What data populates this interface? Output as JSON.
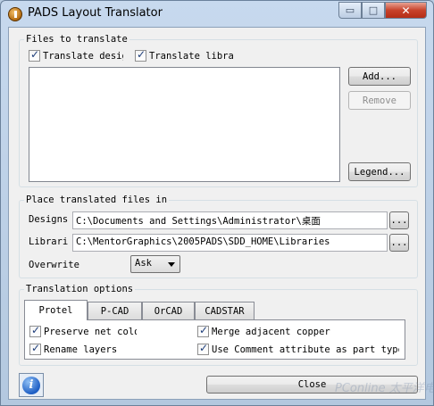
{
  "window": {
    "title": "PADS Layout Translator",
    "min_label": "▭",
    "max_label": "□",
    "close_label": "✕"
  },
  "files": {
    "group_label": "Files to translate",
    "translate_design": {
      "label": "Translate desig",
      "checked": true
    },
    "translate_library": {
      "label": "Translate libra",
      "checked": true
    },
    "add_label": "Add...",
    "remove_label": "Remove",
    "legend_label": "Legend...",
    "items": []
  },
  "place": {
    "group_label": "Place translated files in",
    "designs_label": "Designs",
    "designs_value": "C:\\Documents and Settings\\Administrator\\桌面",
    "libraries_label": "Librari",
    "libraries_value": "C:\\MentorGraphics\\2005PADS\\SDD_HOME\\Libraries",
    "browse_label": "...",
    "overwrite_label": "Overwrite",
    "overwrite_value": "Ask"
  },
  "options": {
    "group_label": "Translation options",
    "tabs": [
      {
        "label": "Protel"
      },
      {
        "label": "P-CAD"
      },
      {
        "label": "OrCAD"
      },
      {
        "label": "CADSTAR"
      }
    ],
    "preserve": {
      "label": "Preserve net colo",
      "checked": true
    },
    "rename": {
      "label": "Rename layers",
      "checked": true
    },
    "merge": {
      "label": "Merge adjacent copper",
      "checked": true
    },
    "use_comment": {
      "label": "Use Comment attribute as part type",
      "checked": true
    }
  },
  "footer": {
    "close_label": "Close",
    "info_glyph": "i"
  },
  "watermark": "PConline 太平洋电脑网"
}
